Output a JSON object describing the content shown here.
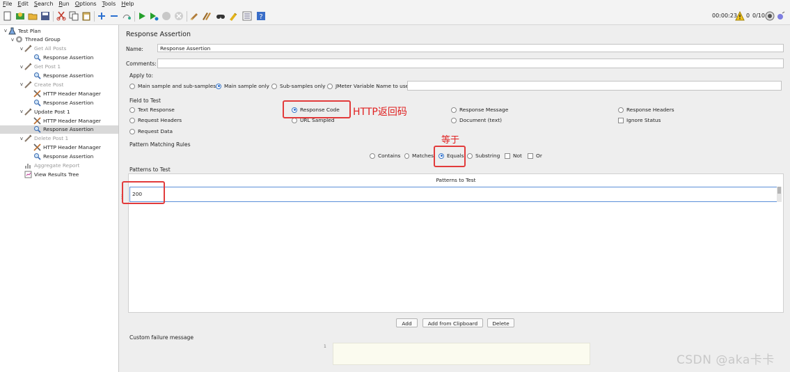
{
  "menu": {
    "items": [
      "File",
      "Edit",
      "Search",
      "Run",
      "Options",
      "Tools",
      "Help"
    ]
  },
  "toolbar": {
    "icons": [
      "new-icon",
      "templates-icon",
      "open-icon",
      "save-icon",
      "cut-icon",
      "copy-icon",
      "paste-icon",
      "expand-icon",
      "collapse-icon",
      "toggle-icon",
      "start-icon",
      "start-no-pause-icon",
      "stop-icon",
      "shutdown-icon",
      "clear-icon",
      "clear-all-icon",
      "search-icon",
      "reset-search-icon",
      "function-helper-icon",
      "help-icon"
    ],
    "timer": "00:00:23",
    "warning_count": "0",
    "threads": "0/10"
  },
  "tree": {
    "nodes": [
      {
        "label": "Test Plan",
        "icon": "test-plan-icon",
        "toggle": "v",
        "level": 0,
        "disabled": false,
        "selected": false
      },
      {
        "label": "Thread Group",
        "icon": "gear-icon",
        "toggle": "v",
        "level": 1,
        "disabled": false,
        "selected": false
      },
      {
        "label": "Get All Posts",
        "icon": "sampler-icon",
        "toggle": "v",
        "level": 2,
        "disabled": true,
        "selected": false
      },
      {
        "label": "Response Assertion",
        "icon": "magnifier-icon",
        "toggle": "",
        "level": 3,
        "disabled": false,
        "selected": false
      },
      {
        "label": "Get Post 1",
        "icon": "sampler-icon",
        "toggle": "v",
        "level": 2,
        "disabled": true,
        "selected": false
      },
      {
        "label": "Response Assertion",
        "icon": "magnifier-icon",
        "toggle": "",
        "level": 3,
        "disabled": false,
        "selected": false
      },
      {
        "label": "Create Post",
        "icon": "sampler-icon",
        "toggle": "v",
        "level": 2,
        "disabled": true,
        "selected": false
      },
      {
        "label": "HTTP Header Manager",
        "icon": "tools-icon",
        "toggle": "",
        "level": 3,
        "disabled": false,
        "selected": false
      },
      {
        "label": "Response Assertion",
        "icon": "magnifier-icon",
        "toggle": "",
        "level": 3,
        "disabled": false,
        "selected": false
      },
      {
        "label": "Update Post 1",
        "icon": "sampler-icon",
        "toggle": "v",
        "level": 2,
        "disabled": false,
        "selected": false
      },
      {
        "label": "HTTP Header Manager",
        "icon": "tools-icon",
        "toggle": "",
        "level": 3,
        "disabled": false,
        "selected": false
      },
      {
        "label": "Response Assertion",
        "icon": "magnifier-icon",
        "toggle": "",
        "level": 3,
        "disabled": false,
        "selected": true
      },
      {
        "label": "Delete Post 1",
        "icon": "sampler-icon",
        "toggle": "v",
        "level": 2,
        "disabled": true,
        "selected": false
      },
      {
        "label": "HTTP Header Manager",
        "icon": "tools-icon",
        "toggle": "",
        "level": 3,
        "disabled": false,
        "selected": false
      },
      {
        "label": "Response Assertion",
        "icon": "magnifier-icon",
        "toggle": "",
        "level": 3,
        "disabled": false,
        "selected": false
      },
      {
        "label": "Aggregate Report",
        "icon": "report-icon",
        "toggle": "",
        "level": 2,
        "disabled": true,
        "selected": false
      },
      {
        "label": "View Results Tree",
        "icon": "results-tree-icon",
        "toggle": "",
        "level": 2,
        "disabled": false,
        "selected": false
      }
    ]
  },
  "panel": {
    "title": "Response Assertion",
    "name_label": "Name:",
    "name_value": "Response Assertion",
    "comments_label": "Comments:",
    "comments_value": "",
    "apply_to": {
      "label": "Apply to:",
      "options": [
        "Main sample and sub-samples",
        "Main sample only",
        "Sub-samples only",
        "JMeter Variable Name to use"
      ],
      "selected": "Main sample only",
      "variable_value": ""
    },
    "field_to_test": {
      "label": "Field to Test",
      "options": [
        "Text Response",
        "Response Code",
        "Response Message",
        "Response Headers",
        "Request Headers",
        "URL Sampled",
        "Document (text)",
        "Ignore Status",
        "Request Data"
      ],
      "selected": "Response Code"
    },
    "pattern_rules": {
      "label": "Pattern Matching Rules",
      "options": [
        "Contains",
        "Matches",
        "Equals",
        "Substring",
        "Not",
        "Or"
      ],
      "selected": "Equals"
    },
    "patterns": {
      "label": "Patterns to Test",
      "column_header": "Patterns to Test",
      "rows": [
        "200"
      ]
    },
    "buttons": {
      "add": "Add",
      "add_clipboard": "Add from Clipboard",
      "delete": "Delete"
    },
    "custom_failure": {
      "label": "Custom failure message",
      "line_number": "1",
      "value": ""
    }
  },
  "annotations": {
    "response_code_note": "HTTP返回码",
    "equals_note": "等于",
    "color": "#e02020"
  },
  "watermark": "CSDN @aka卡卡",
  "colors": {
    "selected_radio": "#2e6fd0",
    "annotation": "#e23b3b",
    "tree_selected": "#d9d9d9"
  }
}
